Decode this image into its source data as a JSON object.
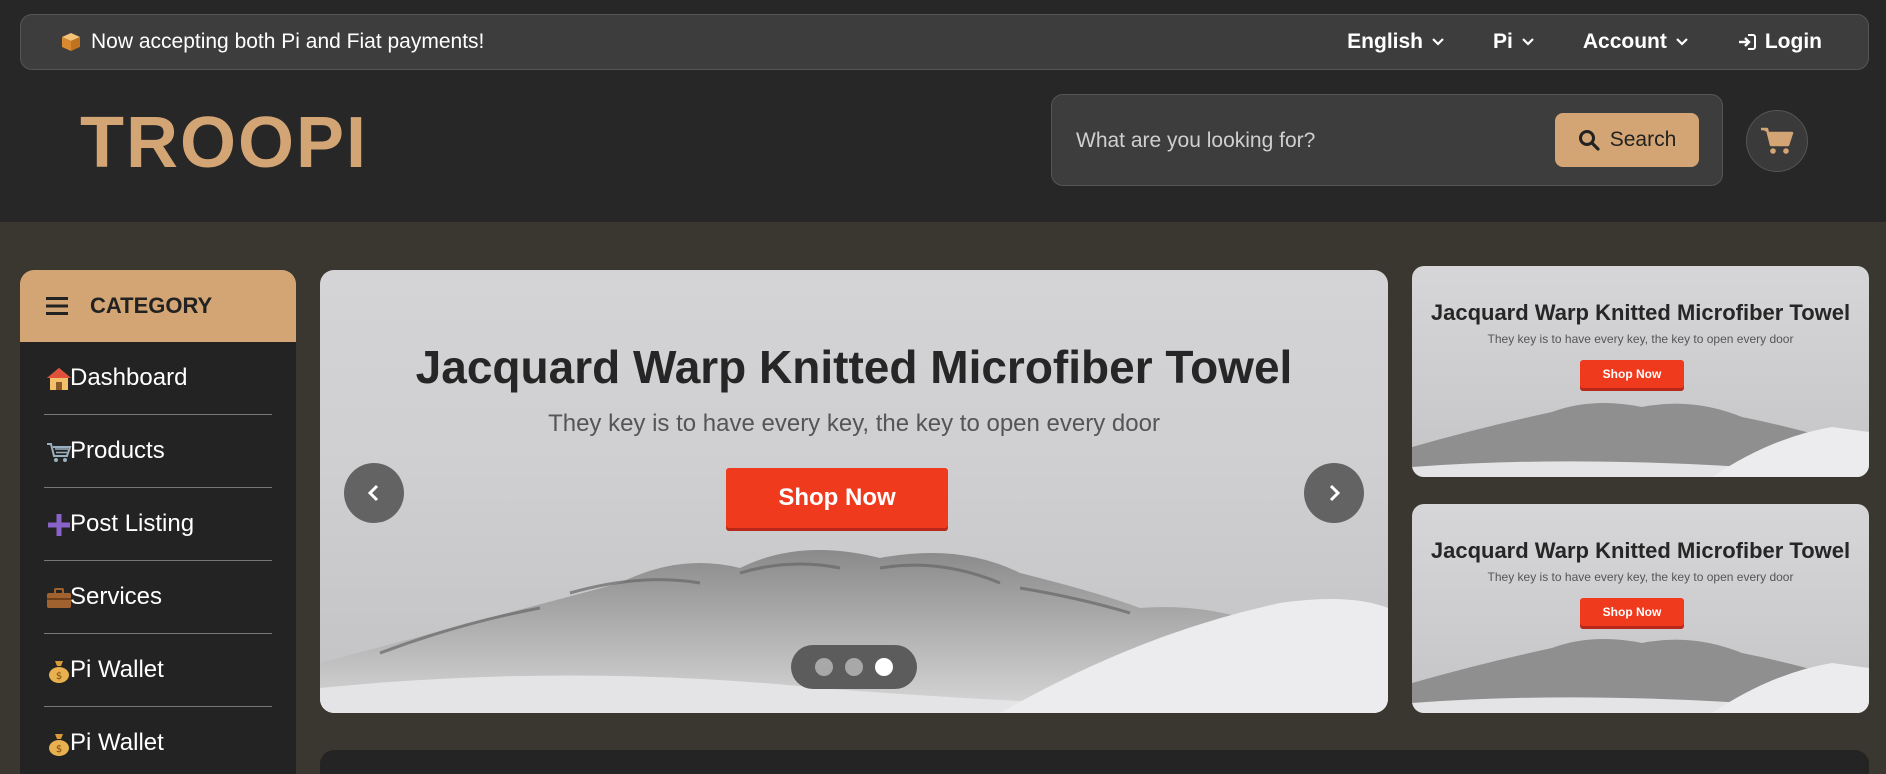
{
  "topbar": {
    "announcement": "Now accepting both Pi and Fiat payments!",
    "language": "English",
    "currency": "Pi",
    "account": "Account",
    "login": "Login"
  },
  "header": {
    "logo": "TROOPI",
    "search_placeholder": "What are you looking for?",
    "search_button": "Search"
  },
  "sidebar": {
    "title": "CATEGORY",
    "items": [
      {
        "label": "Dashboard",
        "icon": "house-icon"
      },
      {
        "label": "Products",
        "icon": "cart-icon"
      },
      {
        "label": "Post Listing",
        "icon": "plus-icon"
      },
      {
        "label": "Services",
        "icon": "briefcase-icon"
      },
      {
        "label": "Pi Wallet",
        "icon": "money-bag-icon"
      },
      {
        "label": "Pi Wallet",
        "icon": "money-bag-icon"
      }
    ]
  },
  "carousel": {
    "title": "Jacquard Warp Knitted Microfiber Towel",
    "subtitle": "They key is to have every key, the key to open every door",
    "button": "Shop Now",
    "active_slide": 3,
    "slide_count": 3
  },
  "side_banners": [
    {
      "title": "Jacquard Warp Knitted Microfiber Towel",
      "subtitle": "They key is to have every key, the key to open every door",
      "button": "Shop Now"
    },
    {
      "title": "Jacquard Warp Knitted Microfiber Towel",
      "subtitle": "They key is to have every key, the key to open every door",
      "button": "Shop Now"
    }
  ],
  "colors": {
    "accent": "#d4a574",
    "header_bg": "#272727",
    "page_bg": "#3a3630",
    "cta_red": "#f03a1e"
  }
}
